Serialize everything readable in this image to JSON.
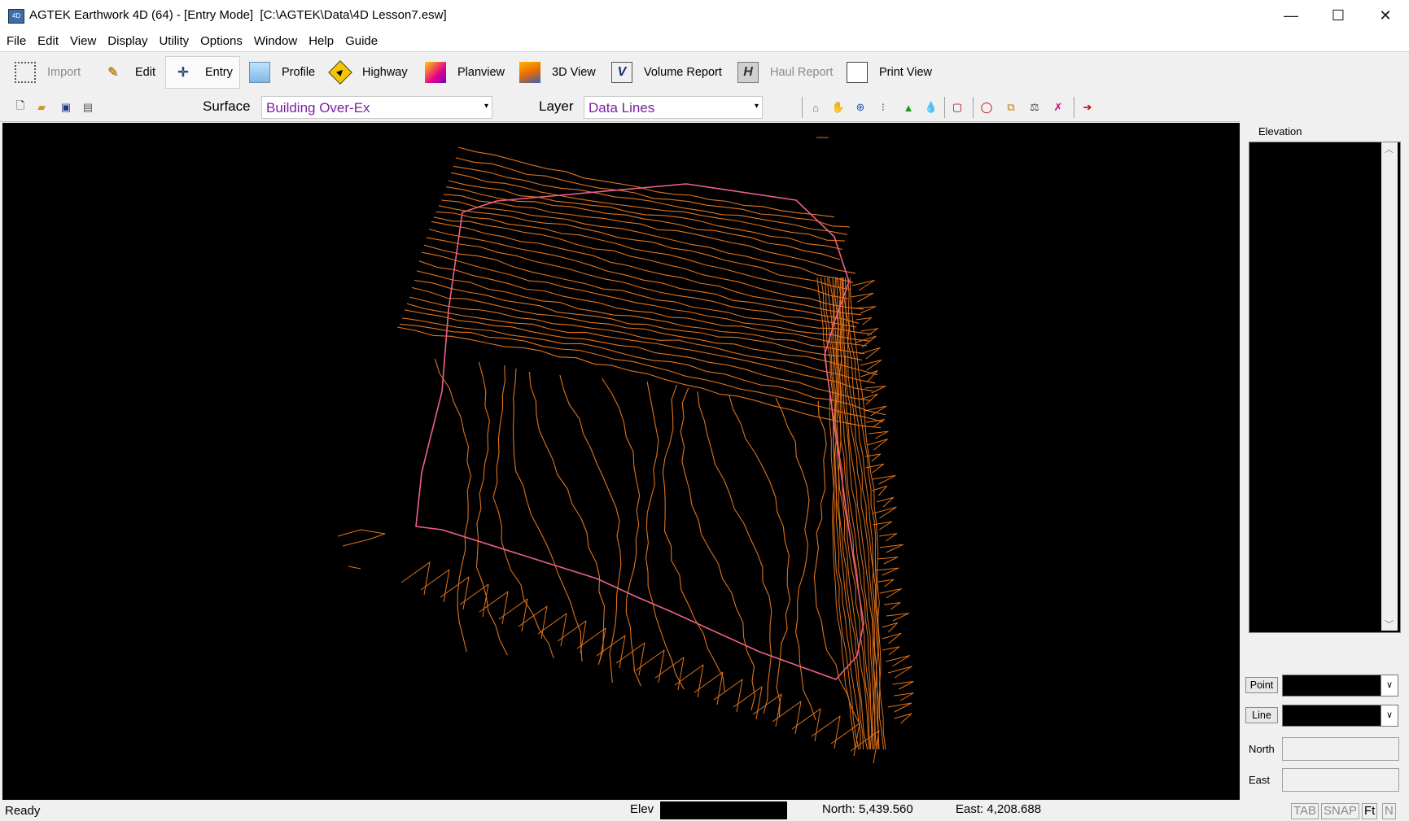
{
  "window": {
    "title": "AGTEK Earthwork 4D (64) - [Entry Mode]  [C:\\AGTEK\\Data\\4D Lesson7.esw]",
    "app_icon": "4D",
    "minimize_glyph": "—",
    "maximize_glyph": "☐",
    "close_glyph": "✕"
  },
  "menu": [
    "File",
    "Edit",
    "View",
    "Display",
    "Utility",
    "Options",
    "Window",
    "Help",
    "Guide"
  ],
  "main_toolbar": {
    "import": {
      "label": "Import",
      "icon": "grid-icon"
    },
    "edit": {
      "label": "Edit",
      "icon": "pencil-icon"
    },
    "entry": {
      "label": "Entry",
      "icon": "crosshair-cursor-icon"
    },
    "profile": {
      "label": "Profile",
      "icon": "profile-icon"
    },
    "highway": {
      "label": "Highway",
      "icon": "highway-sign-icon"
    },
    "planview": {
      "label": "Planview",
      "icon": "planview-icon"
    },
    "view3d": {
      "label": "3D View",
      "icon": "3d-view-icon"
    },
    "volume": {
      "label": "Volume Report",
      "icon": "volume-icon"
    },
    "haul": {
      "label": "Haul Report",
      "icon": "haul-icon"
    },
    "print": {
      "label": "Print View",
      "icon": "print-view-icon"
    }
  },
  "sub_toolbar": {
    "surface_label": "Surface",
    "surface_value": "Building Over-Ex",
    "layer_label": "Layer",
    "layer_value": "Data Lines",
    "combo_arrow": "▾"
  },
  "right_panel": {
    "elevation_label": "Elevation",
    "point_button": "Point",
    "line_button": "Line",
    "north_label": "North",
    "east_label": "East",
    "scroll_up": "︿",
    "scroll_down": "﹀",
    "dropdown_arrow": "∨"
  },
  "status_bar": {
    "ready": "Ready",
    "elev_label": "Elev",
    "north": "North: 5,439.560",
    "east": "East: 4,208.688",
    "indicators": [
      "TAB",
      "SNAP",
      "Ft",
      "N"
    ]
  },
  "colors": {
    "contour": "#e0731c",
    "boundary": "#f0608a",
    "accent_text": "#7b1fa2",
    "canvas_bg": "#000000"
  }
}
